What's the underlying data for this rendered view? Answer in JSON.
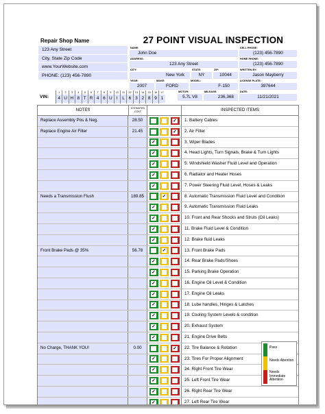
{
  "title": "27 POINT VISUAL INSPECTION",
  "shop": {
    "name": "Repair Shop Name",
    "lines": [
      "123 Any Street",
      "City, State Zip Code",
      "www.YourWebsite.com",
      "PHONE: (123) 456-7890"
    ]
  },
  "customer": {
    "name_label": "NAME:",
    "name": "John Doe",
    "cell_label": "CELL PHONE:",
    "cell": "(123) 456-7890",
    "address_label": "ADDRESS:",
    "address": "123 Any Street",
    "home_label": "HOME PHONE:",
    "home": "(123) 456-7890",
    "city_label": "CITY:",
    "city": "New York",
    "state_label": "STATE:",
    "state": "NY",
    "zip_label": "ZIP:",
    "zip": "10044",
    "writer_label": "WRITTEN BY:",
    "writer": "Jason Mayberry",
    "year_label": "YEAR:",
    "year": "2007",
    "make_label": "MAKE:",
    "make": "FORD",
    "model_label": "MODEL:",
    "model": "F-150",
    "license_label": "LICENSE PLATE:",
    "license": "397644",
    "motor_label": "MOTOR:",
    "motor": "5.7L V8",
    "mileage_label": "MILEAGE:",
    "mileage": "236,368",
    "date_label": "DATE:",
    "date": "11/21/2021"
  },
  "vin": {
    "label": "VIN:",
    "positions": [
      "1",
      "2",
      "3",
      "4",
      "5",
      "6",
      "7",
      "8",
      "9",
      "10",
      "11",
      "12",
      "13",
      "14",
      "15",
      "16",
      "17"
    ],
    "chars": [
      "4",
      "U",
      "H",
      "8",
      "T",
      "R",
      "4",
      "6",
      "U",
      "I",
      "L",
      "6",
      "3",
      "2",
      "8",
      "9",
      "1"
    ]
  },
  "table": {
    "notes_header": "NOTES",
    "cost_header": "ESTIMATED COST",
    "items_header": "INSPECTED ITEMS",
    "rows": [
      {
        "note": "Replace Assembly Pos & Neg.",
        "cost": "28.50",
        "status": "red",
        "item": "1. Battery Cables"
      },
      {
        "note": "Replace Engine Air Filter",
        "cost": "21.45",
        "status": "red",
        "item": "2. Air Filter"
      },
      {
        "note": "",
        "cost": "",
        "status": "green",
        "item": "3. Wiper Blades"
      },
      {
        "note": "",
        "cost": "",
        "status": "green",
        "item": "4. Head Lights, Turn Signals, Brake & Turn Lights"
      },
      {
        "note": "",
        "cost": "",
        "status": "green",
        "item": "5. Windshield Washer Fluid Level and Operation"
      },
      {
        "note": "",
        "cost": "",
        "status": "green",
        "item": "6. Radiator and Heater Hoses"
      },
      {
        "note": "",
        "cost": "",
        "status": "green",
        "item": "7. Power Steering Fluid Level, Hoses & Leaks"
      },
      {
        "note": "Needs a Transmission Flush",
        "cost": "189.85",
        "status": "yellow",
        "item": "8. Automatic Transmission Fluid Level and Condition"
      },
      {
        "note": "",
        "cost": "",
        "status": "green",
        "item": "9. Automatic Transmission Fluid Leaks"
      },
      {
        "note": "",
        "cost": "",
        "status": "green",
        "item": "10. Front and Rear Shocks and Struts (Oil Leaks)"
      },
      {
        "note": "",
        "cost": "",
        "status": "green",
        "item": "11. Brake Fluid Level & Condition"
      },
      {
        "note": "",
        "cost": "",
        "status": "green",
        "item": "12. Brake fluid Leaks"
      },
      {
        "note": "Front Brake Pads @ 35%",
        "cost": "56.78",
        "status": "yellow",
        "item": "13. Front Brake Pads"
      },
      {
        "note": "",
        "cost": "",
        "status": "green",
        "item": "14. Rear Brake Pads/Shoes"
      },
      {
        "note": "",
        "cost": "",
        "status": "green",
        "item": "15. Parking Brake Operation"
      },
      {
        "note": "",
        "cost": "",
        "status": "green",
        "item": "16. Engine Oil Level & Condition"
      },
      {
        "note": "",
        "cost": "",
        "status": "green",
        "item": "17. Engine Oil Leaks"
      },
      {
        "note": "",
        "cost": "",
        "status": "green",
        "item": "18. Lube handles, Hinges & Latches"
      },
      {
        "note": "",
        "cost": "",
        "status": "green",
        "item": "19. Cooling System Levels & condition"
      },
      {
        "note": "",
        "cost": "",
        "status": "green",
        "item": "20. Exhaust System"
      },
      {
        "note": "",
        "cost": "",
        "status": "green",
        "item": "21. Engine Drive Belts"
      },
      {
        "note": "No Charge, THANK YOU!",
        "cost": "0.00",
        "status": "red",
        "item": "22. Tire Balance & Rotation"
      },
      {
        "note": "",
        "cost": "",
        "status": "green",
        "item": "23. Tires For Proper Alignment"
      },
      {
        "note": "",
        "cost": "",
        "status": "green",
        "item": "24. Right Front Tire Wear"
      },
      {
        "note": "",
        "cost": "",
        "status": "green",
        "item": "25. Left Front Tire Wear"
      },
      {
        "note": "",
        "cost": "",
        "status": "green",
        "item": "26. Right Rear Tire Wear"
      },
      {
        "note": "",
        "cost": "",
        "status": "green",
        "item": "27. Left Rear Tire Wear"
      }
    ]
  },
  "legend": {
    "pass": "Pass",
    "attention": "Needs Attention",
    "immediate": "Needs Immediate Attention"
  },
  "colors": {
    "green": "#1f8a2e",
    "yellow": "#f2c200",
    "red": "#c5201d",
    "field": "#dfe3fb"
  }
}
